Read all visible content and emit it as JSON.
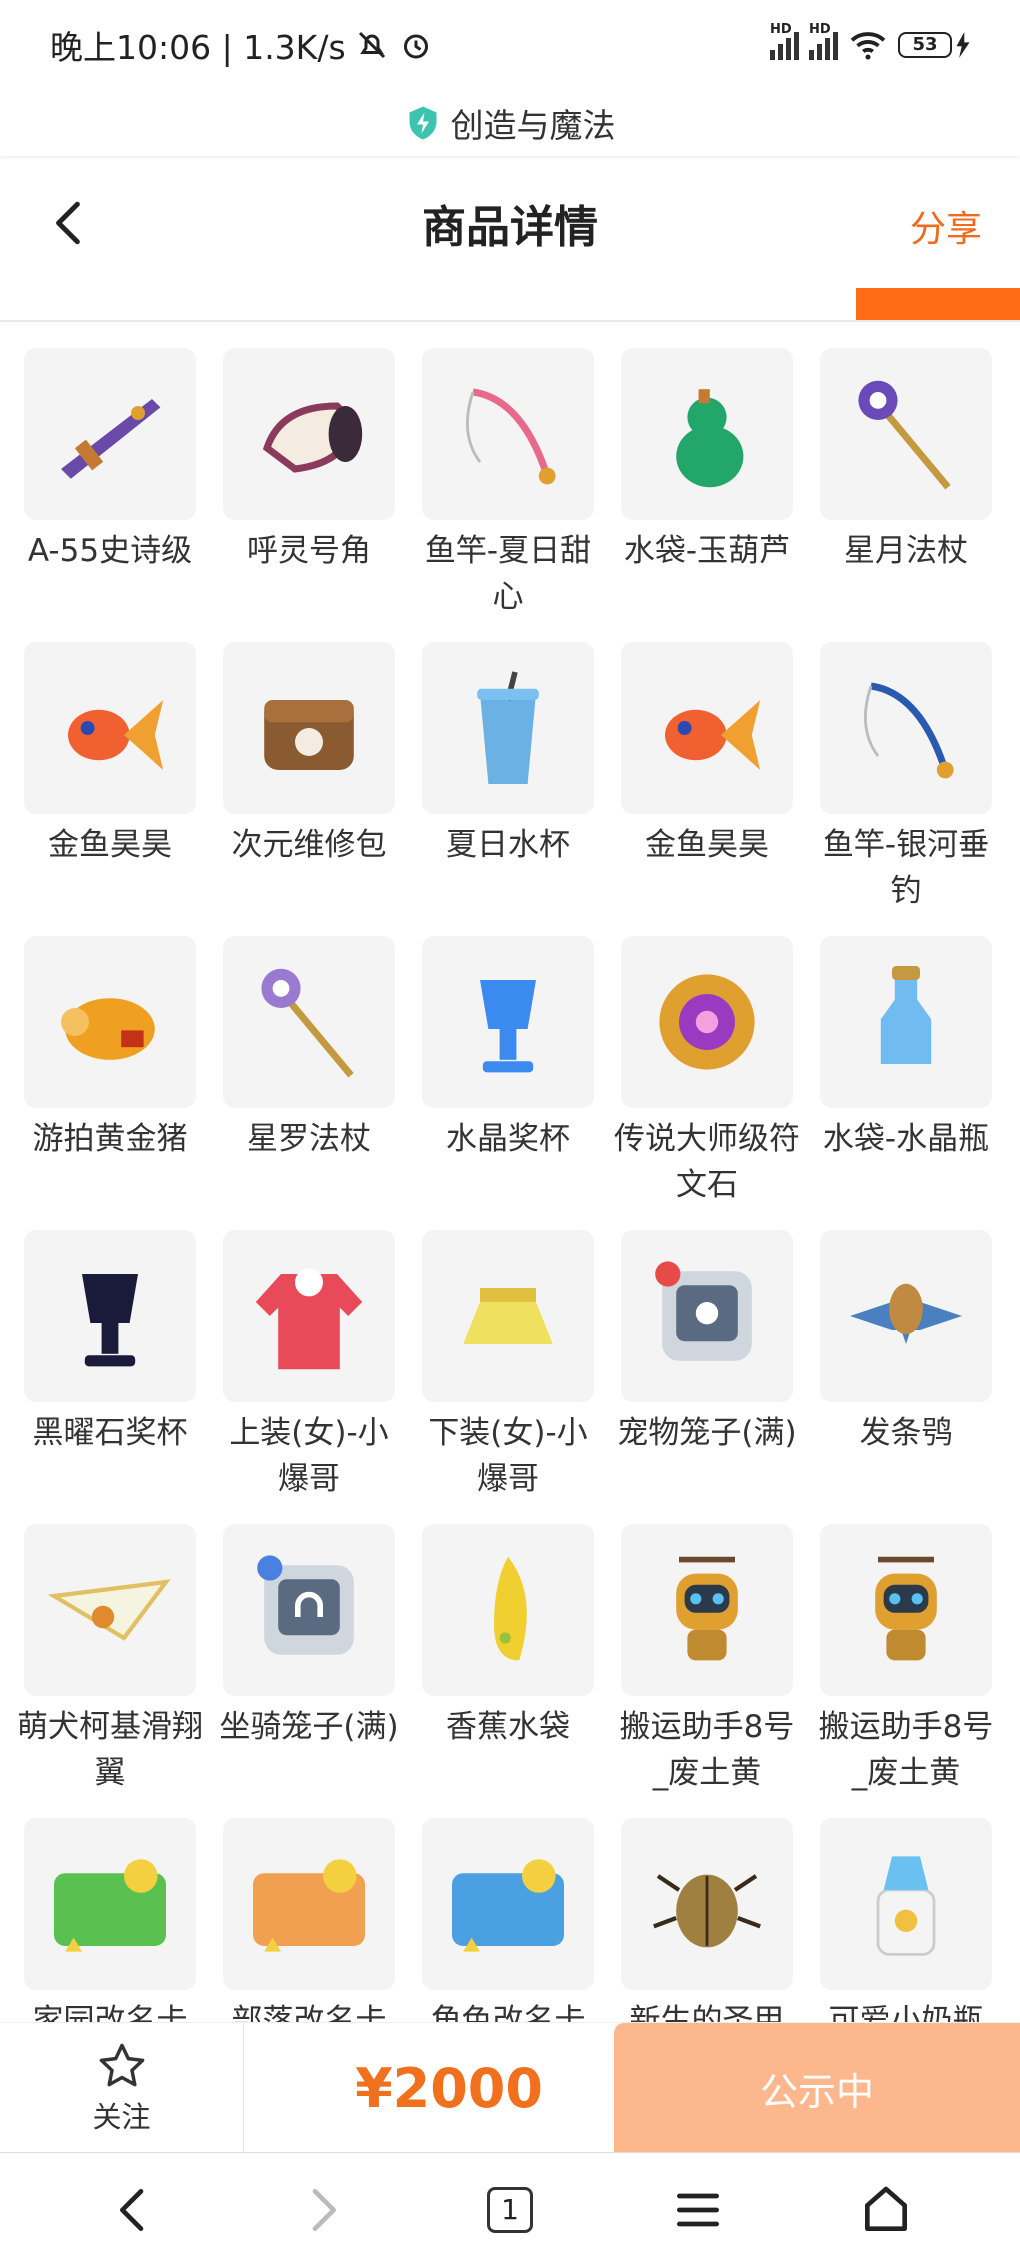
{
  "status": {
    "time_text": "晚上10:06 | 1.3K/s",
    "signal1_badge": "HD",
    "signal2_badge": "HD",
    "battery": "53"
  },
  "app_strip": {
    "name": "创造与魔法"
  },
  "header": {
    "title": "商品详情",
    "share": "分享"
  },
  "items": [
    {
      "label": "A-55史诗级",
      "icon": "rifle-icon",
      "color": "#6a4aa8"
    },
    {
      "label": "呼灵号角",
      "icon": "horn-icon",
      "color": "#8a3a5a"
    },
    {
      "label": "鱼竿-夏日甜心",
      "icon": "fishing-rod-icon",
      "color": "#e86a8a"
    },
    {
      "label": "水袋-玉葫芦",
      "icon": "gourd-icon",
      "color": "#22a66a"
    },
    {
      "label": "星月法杖",
      "icon": "staff-icon",
      "color": "#6a4ab8"
    },
    {
      "label": "金鱼昊昊",
      "icon": "goldfish-icon",
      "color": "#f06030"
    },
    {
      "label": "次元维修包",
      "icon": "bag-icon",
      "color": "#8a5a30"
    },
    {
      "label": "夏日水杯",
      "icon": "cup-icon",
      "color": "#4aa0e0"
    },
    {
      "label": "金鱼昊昊",
      "icon": "goldfish-icon",
      "color": "#f06030"
    },
    {
      "label": "鱼竿-银河垂钓",
      "icon": "fishing-rod-icon",
      "color": "#2a5ab0"
    },
    {
      "label": "游拍黄金猪",
      "icon": "pig-icon",
      "color": "#f0a020"
    },
    {
      "label": "星罗法杖",
      "icon": "staff-icon",
      "color": "#9a7ad0"
    },
    {
      "label": "水晶奖杯",
      "icon": "trophy-icon",
      "color": "#3a8af0"
    },
    {
      "label": "传说大师级符文石",
      "icon": "rune-stone-icon",
      "color": "#e0a030"
    },
    {
      "label": "水袋-水晶瓶",
      "icon": "bottle-icon",
      "color": "#5ab0f0"
    },
    {
      "label": "黑曜石奖杯",
      "icon": "trophy-icon",
      "color": "#1a1a3a"
    },
    {
      "label": "上装(女)-小爆哥",
      "icon": "hoodie-icon",
      "color": "#e84a5a"
    },
    {
      "label": "下装(女)-小爆哥",
      "icon": "skirt-icon",
      "color": "#f0e060"
    },
    {
      "label": "宠物笼子(满)",
      "icon": "pet-cage-icon",
      "color": "#5a6a80"
    },
    {
      "label": "发条鸮",
      "icon": "owl-icon",
      "color": "#c08a40"
    },
    {
      "label": "萌犬柯基滑翔翼",
      "icon": "glider-icon",
      "color": "#e0c060"
    },
    {
      "label": "坐骑笼子(满)",
      "icon": "mount-cage-icon",
      "color": "#5a6a80"
    },
    {
      "label": "香蕉水袋",
      "icon": "banana-icon",
      "color": "#f0d030"
    },
    {
      "label": "搬运助手8号_废土黄",
      "icon": "robot-icon",
      "color": "#e0a030"
    },
    {
      "label": "搬运助手8号_废土黄",
      "icon": "robot-icon",
      "color": "#e0a030"
    },
    {
      "label": "家园改名卡",
      "icon": "card-icon",
      "color": "#5ac050"
    },
    {
      "label": "部落改名卡",
      "icon": "card-icon",
      "color": "#f0a050"
    },
    {
      "label": "角色改名卡",
      "icon": "card-icon",
      "color": "#4aa0e0"
    },
    {
      "label": "新生的圣甲",
      "icon": "beetle-icon",
      "color": "#a08040"
    },
    {
      "label": "可爱小奶瓶",
      "icon": "baby-bottle-icon",
      "color": "#6ac0f0"
    }
  ],
  "action_bar": {
    "follow_label": "关注",
    "price": "¥2000",
    "cta_label": "公示中"
  },
  "nav": {
    "tab_count": "1"
  },
  "colors": {
    "accent": "#ff6a13",
    "cta": "#fdb78c",
    "price": "#f0701e"
  }
}
